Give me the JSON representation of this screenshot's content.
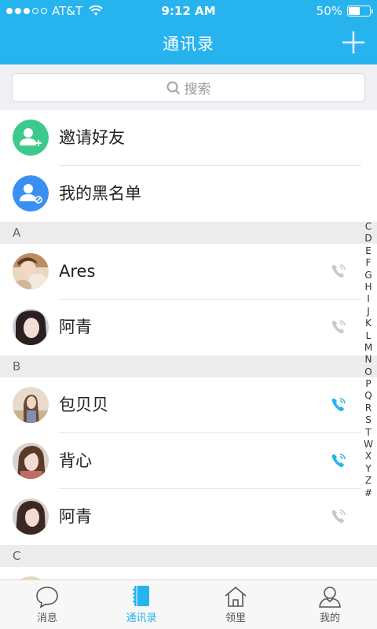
{
  "status_bar": {
    "carrier": "AT&T",
    "time": "9:12 AM",
    "battery_percent": "50%",
    "battery_level": 0.5
  },
  "header": {
    "title": "通讯录",
    "add_icon": "plus-icon"
  },
  "search": {
    "placeholder": "搜索",
    "icon": "search-icon"
  },
  "actions": [
    {
      "label": "邀请好友",
      "icon": "add-user-icon",
      "color": "#3ec98c"
    },
    {
      "label": "我的黑名单",
      "icon": "block-user-icon",
      "color": "#3a8ff2"
    }
  ],
  "sections": [
    {
      "letter": "A",
      "contacts": [
        {
          "name": "Ares",
          "phone_active": false
        },
        {
          "name": "阿青",
          "phone_active": false
        }
      ]
    },
    {
      "letter": "B",
      "contacts": [
        {
          "name": "包贝贝",
          "phone_active": true
        },
        {
          "name": "背心",
          "phone_active": true
        },
        {
          "name": "阿青",
          "phone_active": false
        }
      ]
    },
    {
      "letter": "C",
      "contacts": []
    }
  ],
  "index_letters": [
    "C",
    "D",
    "E",
    "F",
    "G",
    "H",
    "I",
    "J",
    "K",
    "L",
    "M",
    "N",
    "O",
    "P",
    "Q",
    "R",
    "S",
    "T",
    "W",
    "X",
    "Y",
    "Z",
    "#"
  ],
  "tabs": [
    {
      "label": "消息",
      "icon": "chat-bubble-icon",
      "active": false
    },
    {
      "label": "通讯录",
      "icon": "contacts-book-icon",
      "active": true
    },
    {
      "label": "领里",
      "icon": "home-icon",
      "active": false
    },
    {
      "label": "我的",
      "icon": "user-profile-icon",
      "active": false
    }
  ],
  "colors": {
    "brand": "#27b3ee",
    "phone_active": "#27b3ee",
    "phone_inactive": "#c8c8c8",
    "section_bg": "#ececec"
  }
}
